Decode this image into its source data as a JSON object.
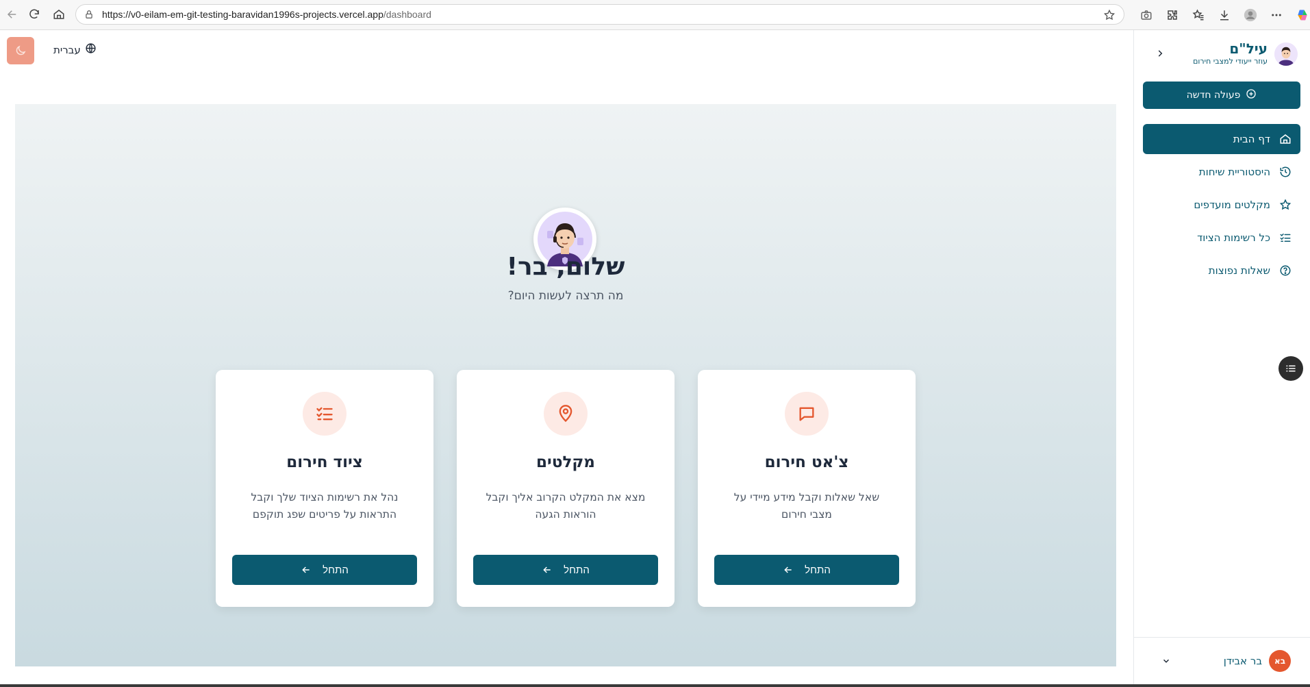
{
  "browser": {
    "url_host": "https://v0-eilam-em-git-testing-baravidan1996s-projects.vercel.app",
    "url_path": "/dashboard"
  },
  "topbar": {
    "language_label": "עברית"
  },
  "hero": {
    "greeting": "שלום, בר!",
    "subtitle": "מה תרצה לעשות היום?"
  },
  "cards": [
    {
      "title": "צ'אט חירום",
      "description": "שאל שאלות וקבל מידע מיידי על מצבי חירום",
      "button_label": "התחל",
      "icon": "chat-icon"
    },
    {
      "title": "מקלטים",
      "description": "מצא את המקלט הקרוב אליך וקבל הוראות הגעה",
      "button_label": "התחל",
      "icon": "map-pin-icon"
    },
    {
      "title": "ציוד חירום",
      "description": "נהל את רשימות הציוד שלך וקבל התראות על פריטים שפג תוקפם",
      "button_label": "התחל",
      "icon": "checklist-icon"
    }
  ],
  "sidebar": {
    "brand_name": "עיל\"ם",
    "brand_subtitle": "עוזר ייעודי למצבי חירום",
    "new_action_label": "פעולה חדשה",
    "items": [
      {
        "label": "דף הבית",
        "icon": "home-icon",
        "active": true
      },
      {
        "label": "היסטוריית שיחות",
        "icon": "history-icon",
        "active": false
      },
      {
        "label": "מקלטים מועדפים",
        "icon": "star-icon",
        "active": false
      },
      {
        "label": "כל רשימות הציוד",
        "icon": "list-check-icon",
        "active": false
      },
      {
        "label": "שאלות נפוצות",
        "icon": "help-circle-icon",
        "active": false
      }
    ],
    "user": {
      "name": "בר אבידן",
      "initials": "בא"
    }
  },
  "colors": {
    "primary": "#0b5a70",
    "accent": "#e4572e",
    "icon_bg": "#fdeae5"
  }
}
